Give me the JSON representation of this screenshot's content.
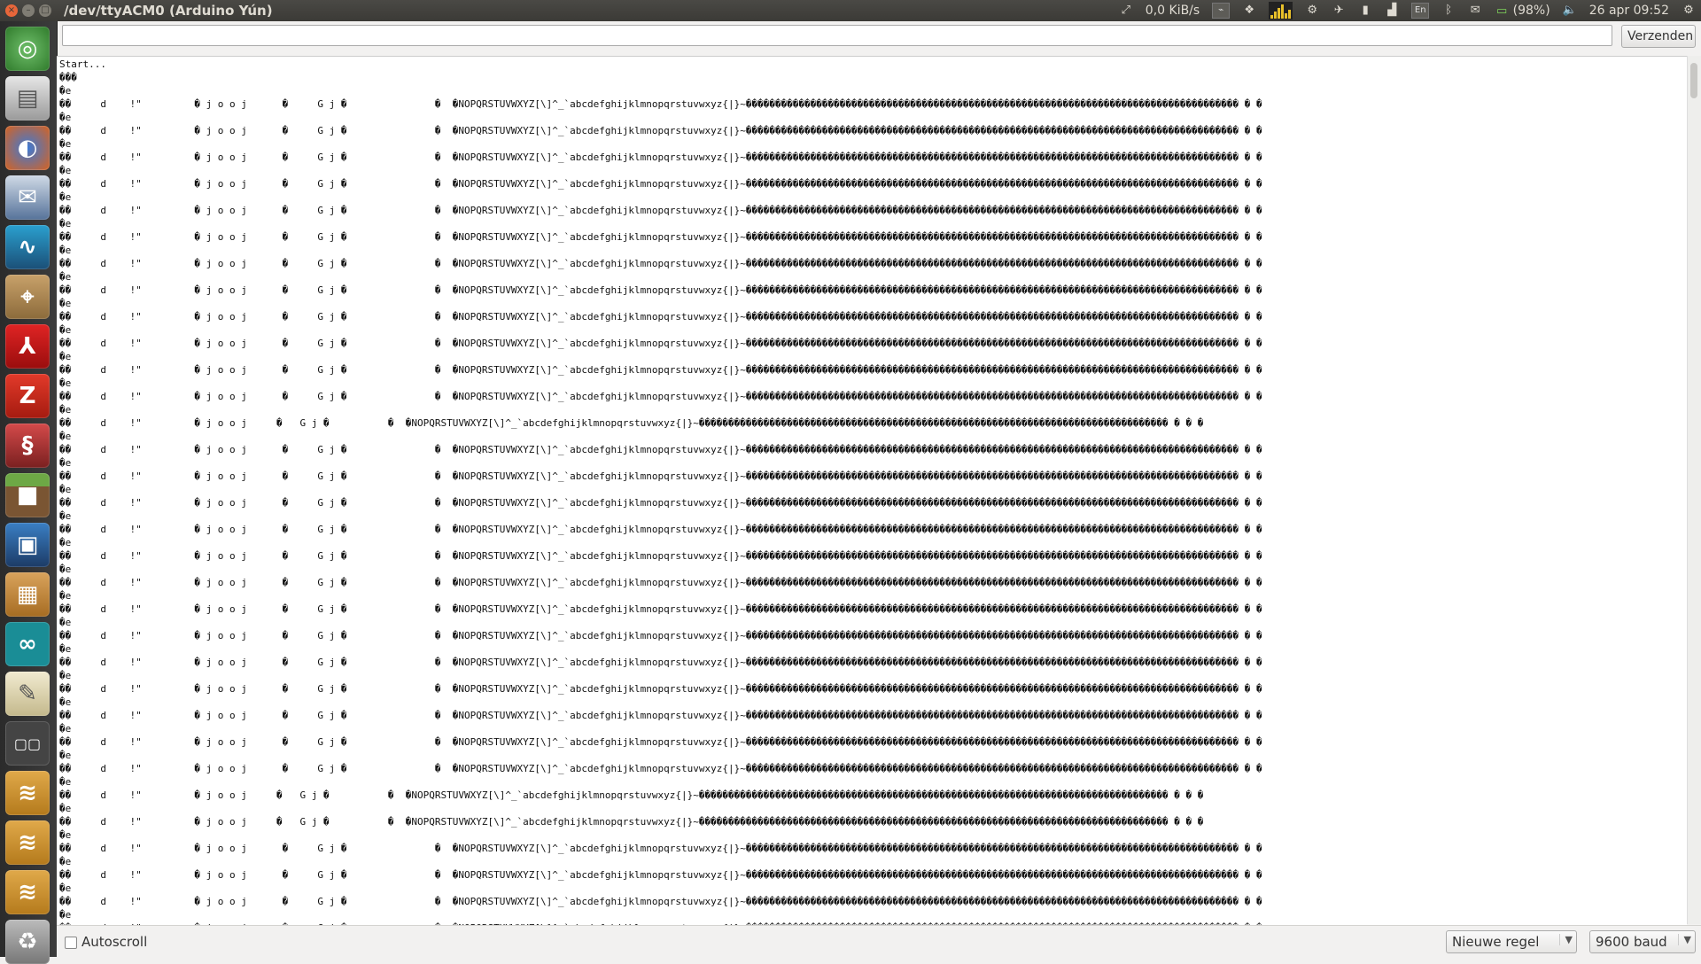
{
  "window": {
    "title": "/dev/ttyACM0 (Arduino Yún)"
  },
  "tray": {
    "net_speed": "0,0 KiB/s",
    "keyboard_layout": "En",
    "battery": "(98%)",
    "datetime": "26 apr 09:52"
  },
  "launcher": {
    "items": [
      "dash-home",
      "files",
      "firefox",
      "thunderbird",
      "wireshark",
      "maps",
      "acrobat-reader",
      "filezilla",
      "python-idle",
      "minecraft",
      "virtualbox",
      "archive-manager",
      "arduino-ide",
      "text-editor",
      "workspace-switcher",
      "network-share-1",
      "network-share-2",
      "network-share-3"
    ]
  },
  "send": {
    "input_value": "",
    "button_label": "Verzenden"
  },
  "output": {
    "header_lines": [
      "Start...",
      "���",
      "�e"
    ],
    "line_a": "��     d    !\"         � j o o j      �     G j �               �  �NOPQRSTUVWXYZ[\\]^_`abcdefghijklmnopqrstuvwxyz{|}~������������������������������������������������������������������������������������ � �",
    "line_b": "�e",
    "line_c": "��     d    !\"         � j o o j     �   G j �          �  �NOPQRSTUVWXYZ[\\]^_`abcdefghijklmnopqrstuvwxyz{|}~�������������������������������������������������������������������������������� � � �",
    "repeat": 32
  },
  "status": {
    "autoscroll_label": "Autoscroll",
    "autoscroll_checked": false,
    "line_ending": "Nieuwe regel",
    "baud_rate": "9600 baud"
  },
  "colors": {
    "panel_bg": "#3b3a36",
    "window_bg": "#f2f1f0",
    "output_bg": "#ffffff"
  }
}
